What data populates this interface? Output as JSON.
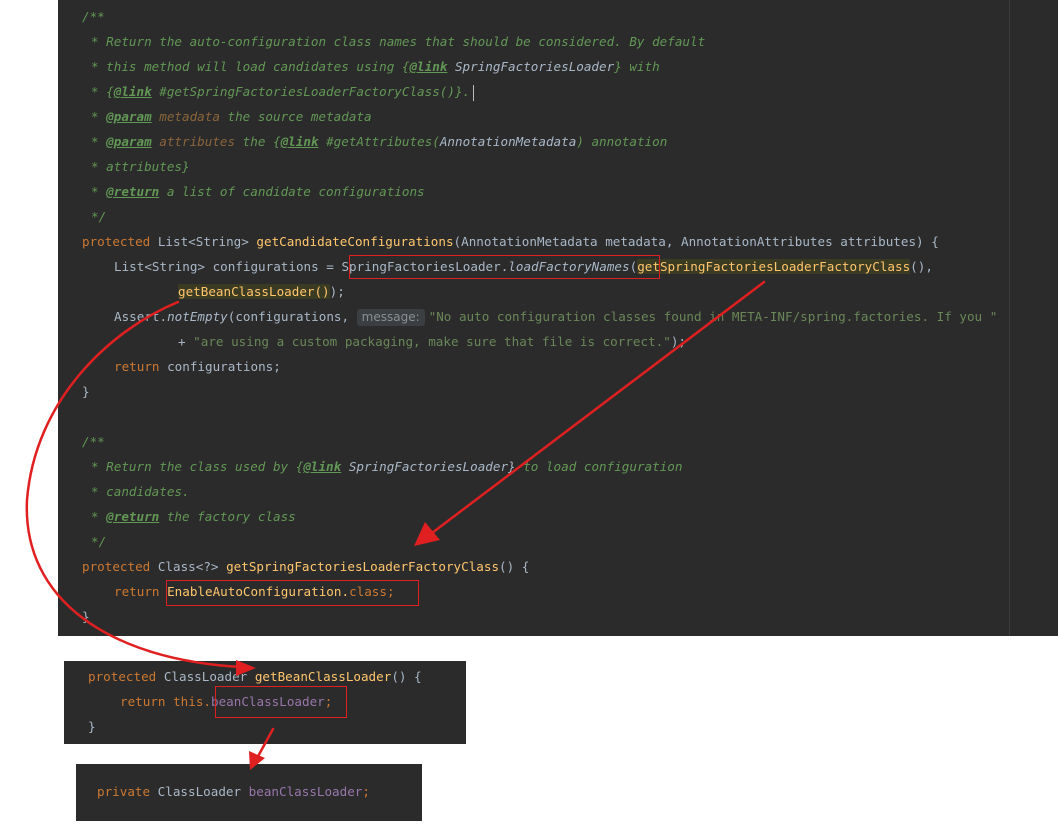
{
  "main_code": {
    "doc1": {
      "open": "/**",
      "l1": "* Return the auto-configuration class names that should be considered. By default",
      "l2a": "* this method will load candidates using {",
      "l2b": "@link",
      "l2c": " SpringFactoriesLoader",
      "l2d": "} with",
      "l3a": "* {",
      "l3b": "@link",
      "l3c": " #getSpringFactoriesLoaderFactoryClass()}.",
      "l4a": "* ",
      "l4b": "@param",
      "l4c": " metadata",
      "l4d": " the source metadata",
      "l5a": "* ",
      "l5b": "@param",
      "l5c": " attributes",
      "l5d": " the {",
      "l5e": "@link",
      "l5f": " #getAttributes(",
      "l5g": "AnnotationMetadata",
      "l5h": ") annotation",
      "l6": "* attributes}",
      "l7a": "* ",
      "l7b": "@return",
      "l7c": " a list of candidate configurations",
      "close": "*/"
    },
    "sig1": {
      "modifier": "protected",
      "ret_type": " List<String> ",
      "name": "getCandidateConfigurations",
      "params": "(AnnotationMetadata metadata, AnnotationAttributes attributes) {"
    },
    "body1": {
      "decl": "List<String> configurations = ",
      "loader": "SpringFactoriesLoader.",
      "load_call": "loadFactoryNames",
      "paren": "(",
      "arg1": "getSpringFactoriesLoaderFactoryClass",
      "arg1_end": "(),",
      "arg2": "getBeanClassLoader()",
      "arg2_end": ");",
      "assert_obj": "Assert.",
      "assert_fn": "notEmpty",
      "assert_args": "(configurations, ",
      "hint_label": "message:",
      "msg1": "\"No auto configuration classes found in META-INF/spring.factories. If you \"",
      "plus": "+ ",
      "msg2": "\"are using a custom packaging, make sure that file is correct.\"",
      "msg2_end": ");",
      "return_kw": "return",
      "return_val": " configurations;",
      "close": "}"
    },
    "doc2": {
      "open": "/**",
      "l1a": "* Return the class used by {",
      "l1b": "@link",
      "l1c": " SpringFactoriesLoader}",
      "l1d": " to load configuration",
      "l2": "* candidates.",
      "l3a": "* ",
      "l3b": "@return",
      "l3c": " the factory class",
      "close": "*/"
    },
    "sig2": {
      "modifier": "protected",
      "ret_type": " Class<?> ",
      "name": "getSpringFactoriesLoaderFactoryClass",
      "tail": "() {"
    },
    "body2": {
      "return_kw": "return ",
      "cls": "EnableAutoConfiguration.",
      "cls_kw": "class",
      "semi": ";",
      "close": "}"
    }
  },
  "getter_snippet": {
    "modifier": "protected",
    "ret_type": " ClassLoader ",
    "name": "getBeanClassLoader",
    "tail": "() {",
    "return_kw": "return ",
    "this_kw": "this.",
    "field": "beanClassLoader",
    "semi": ";",
    "close": "}"
  },
  "field_snippet": {
    "modifier": "private",
    "type": " ClassLoader ",
    "field": "beanClassLoader",
    "semi": ";"
  },
  "colors": {
    "editor_bg": "#2b2b2b",
    "keyword": "#cc7832",
    "method": "#ffc66d",
    "doc_comment": "#629755",
    "string": "#6a8759",
    "field": "#9876aa",
    "annotation_red": "#e02020"
  }
}
